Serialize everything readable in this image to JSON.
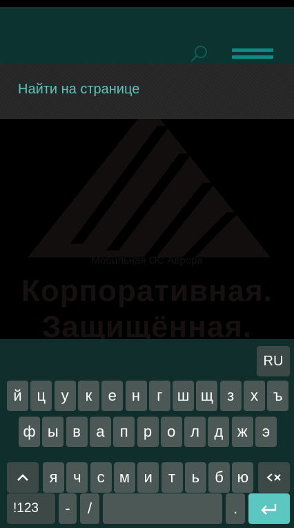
{
  "find_bar": {
    "placeholder": "Найти на странице"
  },
  "page_content": {
    "subtitle": "Мобильная ОС Аврора",
    "heading_line1": "Корпоративная.",
    "heading_line2": "Защищённая."
  },
  "keyboard": {
    "language_label": "RU",
    "row1": [
      "й",
      "ц",
      "у",
      "к",
      "е",
      "н",
      "г",
      "ш",
      "щ",
      "з",
      "х",
      "ъ"
    ],
    "row2": [
      "ф",
      "ы",
      "в",
      "а",
      "п",
      "р",
      "о",
      "л",
      "д",
      "ж",
      "э"
    ],
    "row3": [
      "я",
      "ч",
      "с",
      "м",
      "и",
      "т",
      "ь",
      "б",
      "ю"
    ],
    "symbols_label": "!123",
    "dash_label": "-",
    "slash_label": "/",
    "dot_label": ".",
    "icons": {
      "shift": "shift-icon",
      "backspace": "backspace-icon",
      "enter": "enter-icon"
    }
  },
  "colors": {
    "header_bg": "#0c3330",
    "accent": "#5dc3bc",
    "key_bg": "#4b5856",
    "keyboard_bg": "#0f2e2c",
    "enter_key_bg": "#5cc7c1"
  }
}
